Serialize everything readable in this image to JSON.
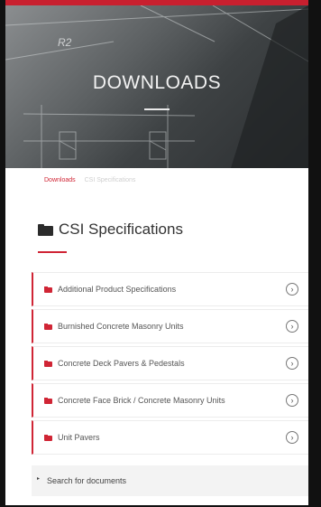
{
  "hero": {
    "title": "DOWNLOADS",
    "drawing_mark": "R2"
  },
  "breadcrumb": {
    "link": "Downloads",
    "current": "CSI Specifications"
  },
  "section": {
    "title": "CSI Specifications",
    "icon": "folder-icon"
  },
  "documents": [
    {
      "label": "Additional Product Specifications",
      "icon": "folder-icon"
    },
    {
      "label": "Burnished Concrete Masonry Units",
      "icon": "folder-icon"
    },
    {
      "label": "Concrete Deck Pavers & Pedestals",
      "icon": "folder-icon"
    },
    {
      "label": "Concrete Face Brick / Concrete Masonry Units",
      "icon": "folder-icon"
    },
    {
      "label": "Unit Pavers",
      "icon": "folder-icon"
    }
  ],
  "chevron_glyph": "›",
  "search": {
    "label": "Search for documents",
    "caret": "▸"
  },
  "colors": {
    "accent": "#d02535",
    "text": "#333333"
  }
}
